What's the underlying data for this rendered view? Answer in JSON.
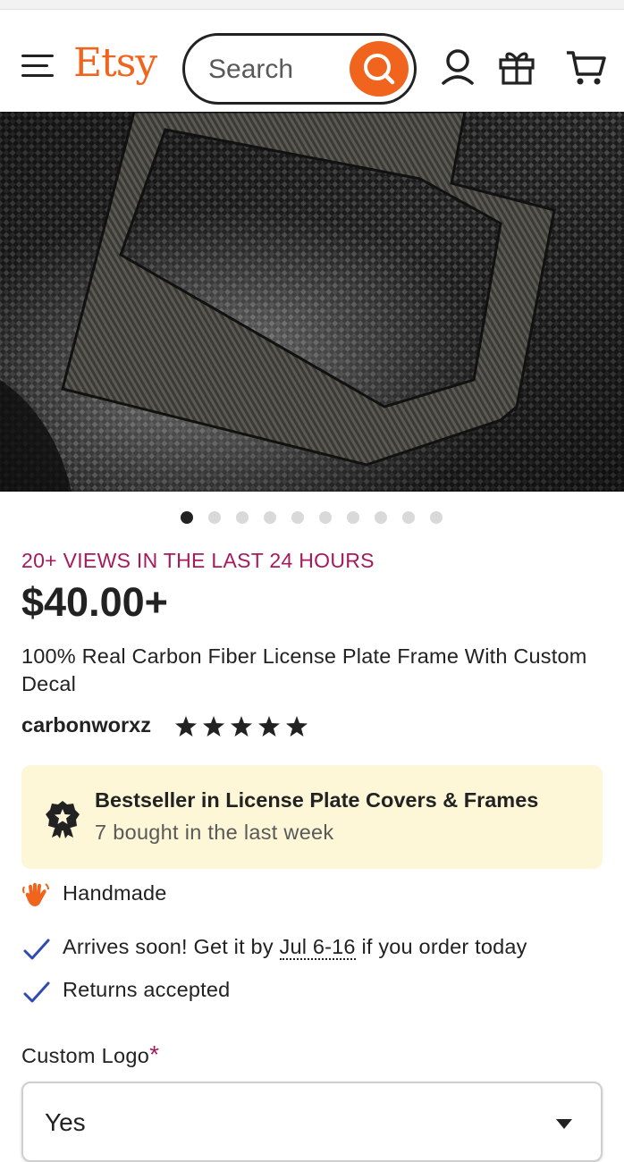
{
  "header": {
    "logo": "Etsy",
    "search_placeholder": "Search"
  },
  "hero": {
    "image_count": 10,
    "active_index": 0
  },
  "listing": {
    "views_notice": "20+ VIEWS IN THE LAST 24 HOURS",
    "price": "$40.00+",
    "title": "100% Real Carbon Fiber License Plate Frame With Custom Decal",
    "shop_name": "carbonworxz",
    "rating_stars": 5
  },
  "badge": {
    "title": "Bestseller in License Plate Covers & Frames",
    "subtitle": "7 bought in the last week"
  },
  "features": {
    "handmade": "Handmade",
    "arrives_prefix": "Arrives soon! Get it by ",
    "arrives_date": "Jul 6-16",
    "arrives_suffix": " if you order today",
    "returns": "Returns accepted"
  },
  "options": {
    "custom_logo_label": "Custom Logo",
    "required_mark": "*",
    "custom_logo_value": "Yes"
  },
  "colors": {
    "brand": "#f1641e",
    "views": "#a61a5c",
    "check": "#2f4bb3",
    "badge_bg": "#fdf7d8"
  }
}
